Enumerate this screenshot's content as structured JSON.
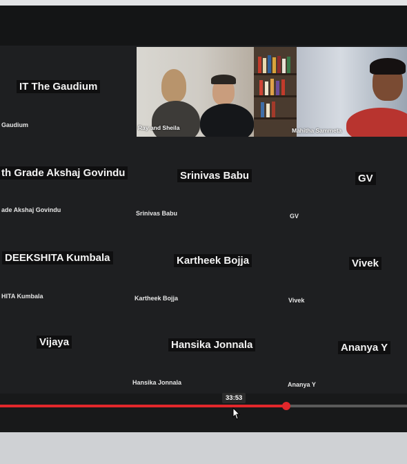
{
  "participants": {
    "it_gaudium": {
      "name": "IT The Gaudium",
      "label": "Gaudium"
    },
    "akshaj": {
      "name": "th Grade Akshaj Govindu",
      "label": "ade Akshaj Govindu"
    },
    "srinivas": {
      "name": "Srinivas Babu",
      "label": "Srinivas Babu"
    },
    "gv": {
      "name": "GV",
      "label": "GV"
    },
    "deekshita": {
      "name": "DEEKSHITA Kumbala",
      "label": "HITA Kumbala"
    },
    "kartheek": {
      "name": "Kartheek Bojja",
      "label": "Kartheek Bojja"
    },
    "vivek": {
      "name": "Vivek",
      "label": "Vivek"
    },
    "vijaya": {
      "name": "Vijaya"
    },
    "hansika": {
      "name": "Hansika Jonnala",
      "label": "Hansika Jonnala"
    },
    "ananya": {
      "name": "Ananya Y",
      "label": "Ananya Y"
    }
  },
  "video_feeds": {
    "ray_sheila": {
      "label": "Ray and Sheila"
    },
    "mahitha": {
      "label": "Mahitha Sammeta"
    }
  },
  "player": {
    "timestamp": "33:53",
    "progress": 0.703,
    "accent_color": "#e1272b"
  }
}
